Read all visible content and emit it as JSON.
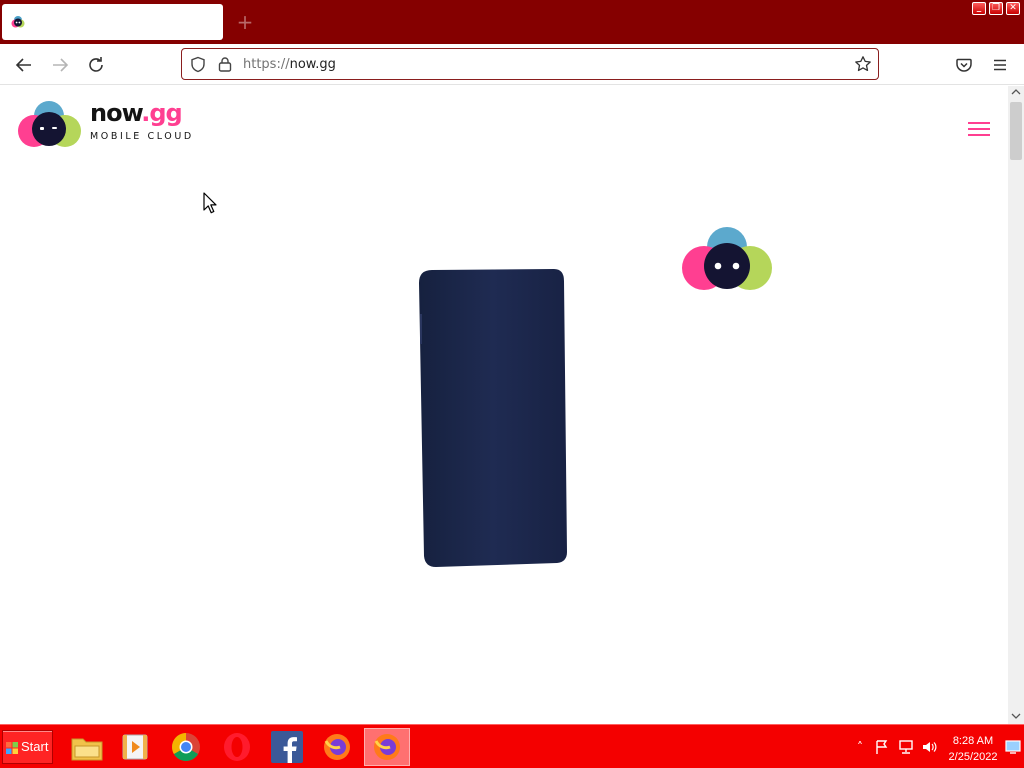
{
  "browser": {
    "tab_title": "",
    "new_tab_label": "+",
    "url_scheme": "https://",
    "url_host": "now.gg",
    "window_controls": [
      "minimize",
      "restore",
      "close"
    ]
  },
  "page": {
    "logo": {
      "word": "now",
      "suffix": ".gg",
      "tagline": "MOBILE CLOUD"
    }
  },
  "taskbar": {
    "start_label": "Start",
    "items": [
      "file-explorer",
      "media-player",
      "chrome",
      "opera",
      "facebook",
      "firefox",
      "firefox-active"
    ],
    "clock_time": "8:28 AM",
    "clock_date": "2/25/2022"
  },
  "colors": {
    "titlebar": "#850000",
    "taskbar": "#f40000",
    "brand_pink": "#ff3f91",
    "brand_blue": "#4aa0c8",
    "brand_green": "#b5d65a",
    "phone": "#1e2a4f"
  }
}
